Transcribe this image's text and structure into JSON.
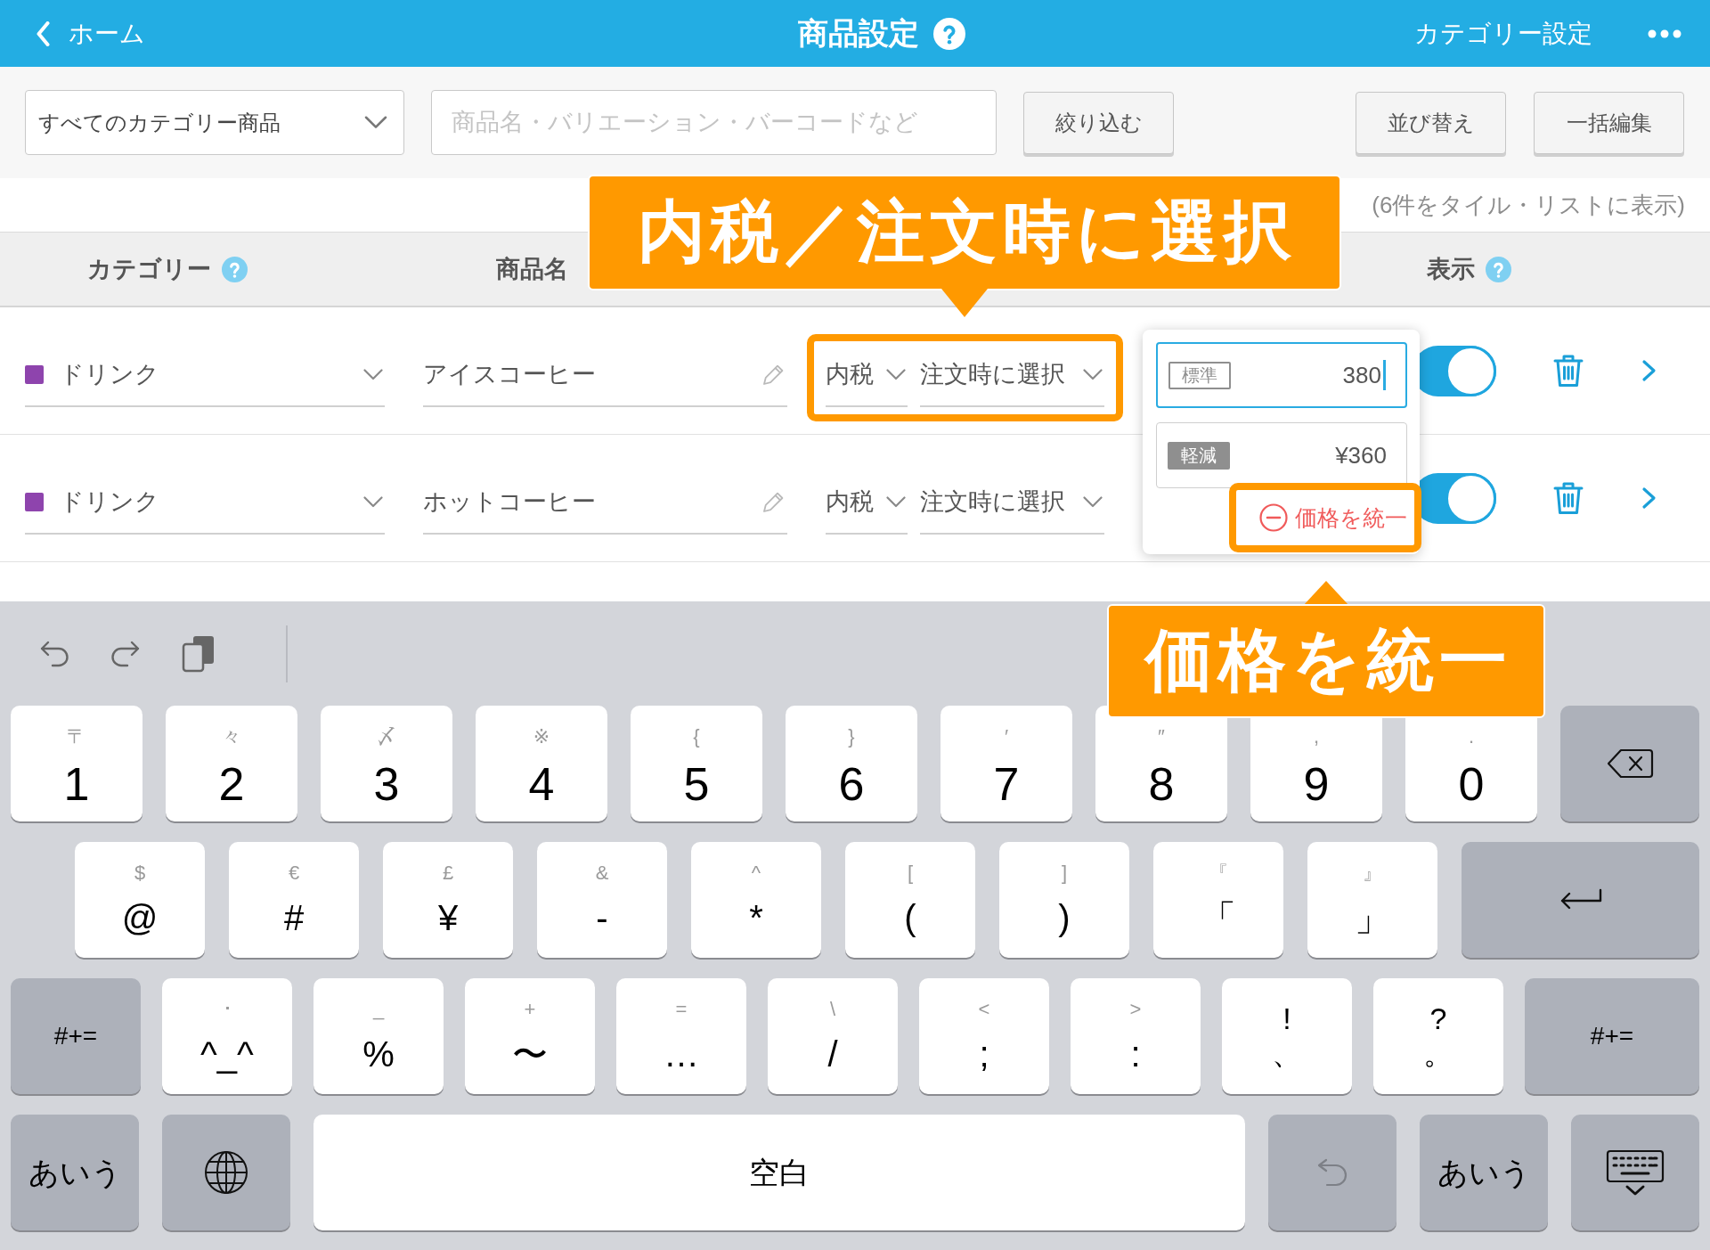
{
  "header": {
    "back": "ホーム",
    "title": "商品設定",
    "help": true,
    "link": "カテゴリー設定"
  },
  "filter_bar": {
    "category": "すべてのカテゴリー商品",
    "search": {
      "placeholder": "商品名・バリエーション・バーコードなど"
    },
    "filter_button": "絞り込む",
    "buttons": [
      "並び替え",
      "一括編集"
    ]
  },
  "summary": "(6件をタイル・リストに表示)",
  "table": {
    "columns": [
      {
        "label": "カテゴリー",
        "help": true
      },
      {
        "label": "商品名",
        "help": false
      },
      {
        "label": "表示",
        "help": true
      }
    ],
    "rows": [
      {
        "category": "ドリンク",
        "color": "#8e44ad",
        "name": "アイスコーヒー",
        "tax": "内税",
        "tax_rate": "注文時に選択",
        "on": true
      },
      {
        "category": "ドリンク",
        "color": "#8e44ad",
        "name": "ホットコーヒー",
        "tax": "内税",
        "tax_rate": "注文時に選択",
        "on": true
      }
    ]
  },
  "price_popup": {
    "prices": [
      {
        "kind": "standard",
        "badge": "標準",
        "value": "380",
        "focused": true
      },
      {
        "kind": "reduced",
        "badge": "軽減",
        "value": "¥360",
        "focused": false
      }
    ],
    "unify_button": "価格を統一"
  },
  "callouts": [
    {
      "text": "内税／注文時に選択"
    },
    {
      "text": "価格を統一"
    }
  ],
  "keyboard": {
    "rows": [
      [
        {
          "kind": "char",
          "hint": "〒",
          "label": "1"
        },
        {
          "kind": "char",
          "hint": "々",
          "label": "2"
        },
        {
          "kind": "char",
          "hint": "〆",
          "label": "3"
        },
        {
          "kind": "char",
          "hint": "※",
          "label": "4"
        },
        {
          "kind": "char",
          "hint": "{",
          "label": "5"
        },
        {
          "kind": "char",
          "hint": "}",
          "label": "6"
        },
        {
          "kind": "char",
          "hint": "′",
          "label": "7"
        },
        {
          "kind": "char",
          "hint": "″",
          "label": "8"
        },
        {
          "kind": "char",
          "hint": ",",
          "label": "9"
        },
        {
          "kind": "char",
          "hint": ".",
          "label": "0"
        },
        {
          "kind": "backspace"
        }
      ],
      [
        {
          "kind": "char",
          "hint": "$",
          "label": "@"
        },
        {
          "kind": "char",
          "hint": "€",
          "label": "#"
        },
        {
          "kind": "char",
          "hint": "£",
          "label": "¥"
        },
        {
          "kind": "char",
          "hint": "&",
          "label": "-"
        },
        {
          "kind": "char",
          "hint": "^",
          "label": "*"
        },
        {
          "kind": "char",
          "hint": "[",
          "label": "("
        },
        {
          "kind": "char",
          "hint": "]",
          "label": ")"
        },
        {
          "kind": "char",
          "hint": "『",
          "label": "「"
        },
        {
          "kind": "char",
          "hint": "』",
          "label": "」"
        },
        {
          "kind": "return"
        }
      ],
      [
        {
          "kind": "function",
          "label": "#+="
        },
        {
          "kind": "char",
          "hint": "･",
          "label": "^_^"
        },
        {
          "kind": "char",
          "hint": "_",
          "label": "%"
        },
        {
          "kind": "char",
          "hint": "+",
          "label": "〜"
        },
        {
          "kind": "char",
          "hint": "=",
          "label": "…"
        },
        {
          "kind": "char",
          "hint": "\\",
          "label": "/"
        },
        {
          "kind": "char",
          "hint": "<",
          "label": ";"
        },
        {
          "kind": "char",
          "hint": ">",
          "label": ":"
        },
        {
          "kind": "pair",
          "hint": "!",
          "label": "、"
        },
        {
          "kind": "pair",
          "hint": "?",
          "label": "。"
        },
        {
          "kind": "function",
          "label": "#+="
        }
      ],
      [
        {
          "kind": "function",
          "label": "あいう"
        },
        {
          "kind": "language"
        },
        {
          "kind": "space",
          "label": "空白"
        },
        {
          "kind": "undo"
        },
        {
          "kind": "function",
          "label": "あいう"
        },
        {
          "kind": "hide_keyboard"
        }
      ]
    ]
  }
}
